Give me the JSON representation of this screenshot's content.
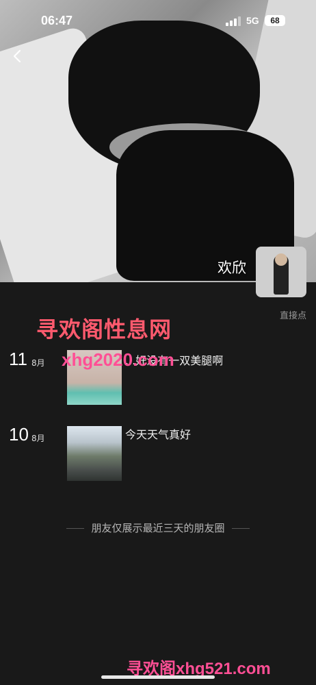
{
  "status_bar": {
    "time": "06:47",
    "network": "5G",
    "battery": "68"
  },
  "profile": {
    "name": "欢欣",
    "direct_link": "直接点"
  },
  "watermarks": {
    "top": "寻欢阁性息网",
    "middle": "xhg2020.com",
    "bottom": "寻欢阁xhg521.com"
  },
  "posts": [
    {
      "day": "11",
      "month": "8月",
      "text": "...好没有一双美腿啊"
    },
    {
      "day": "10",
      "month": "8月",
      "text": "今天天气真好"
    }
  ],
  "footer_note": "朋友仅展示最近三天的朋友圈",
  "icons": {
    "back": "chevron-left-icon",
    "signal": "signal-icon"
  }
}
